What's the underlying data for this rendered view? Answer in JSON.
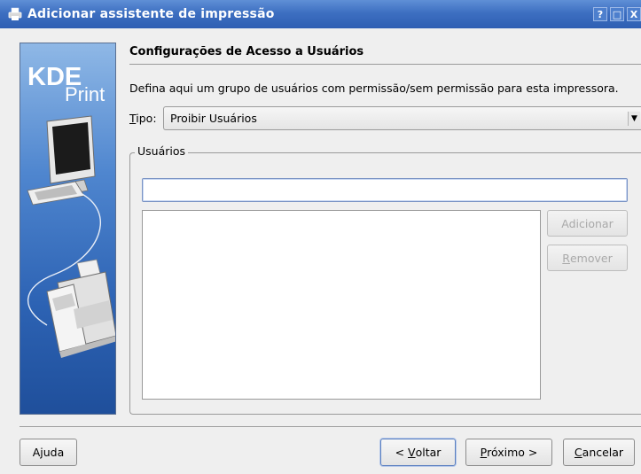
{
  "window": {
    "title": "Adicionar assistente de impressão",
    "controls": [
      "?",
      "□",
      "X"
    ]
  },
  "banner": {
    "line1": "KDE",
    "line2": "Print"
  },
  "page": {
    "section_title": "Configurações de Acesso a Usuários",
    "description": "Defina aqui um grupo de usuários com permissão/sem permissão para esta impressora.",
    "tipo_label_mnemonic": "T",
    "tipo_label_rest": "ipo:",
    "tipo_value": "Proibir Usuários",
    "group_title": "Usuários",
    "user_input_value": "",
    "add_label": "Adicionar",
    "remove_label_mnemonic": "R",
    "remove_label_rest": "emover"
  },
  "footer": {
    "help_label": "Ajuda",
    "back_prefix": "< ",
    "back_mnemonic": "V",
    "back_rest": "oltar",
    "next_mnemonic": "P",
    "next_rest": "róximo >",
    "cancel_mnemonic": "C",
    "cancel_rest": "ancelar"
  }
}
